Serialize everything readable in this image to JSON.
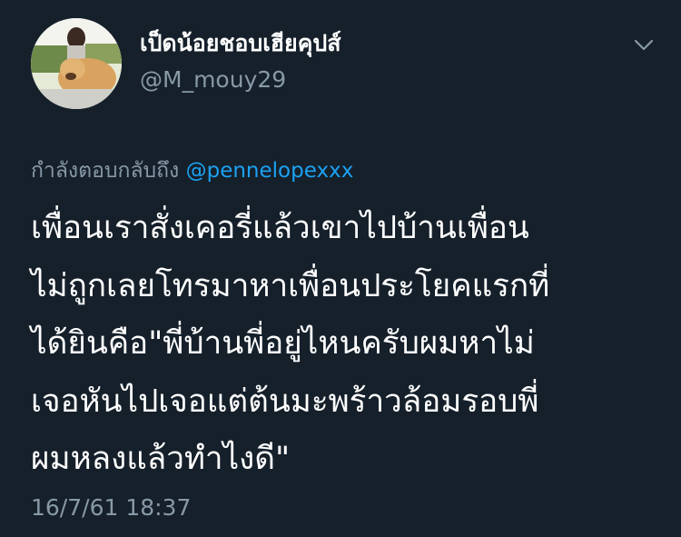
{
  "author": {
    "display_name": "เป็ดน้อยชอบเฮียคุปส์",
    "handle": "@M_mouy29"
  },
  "reply": {
    "prefix": "กำลังตอบกลับถึง",
    "mention": "@pennelopexxx"
  },
  "tweet": {
    "lines": [
      "เพื่อนเราสั่งเคอรี่แล้วเขาไปบ้านเพื่อน",
      "ไม่ถูกเลยโทรมาหาเพื่อนประโยคแรกที่",
      "ได้ยินคือ\"พี่บ้านพี่อยู่ไหนครับผมหาไม่",
      "เจอหันไปเจอแต่ต้นมะพร้าวล้อมรอบพี่",
      "ผมหลงแล้วทำไงดี\""
    ],
    "timestamp": "16/7/61 18:37"
  },
  "colors": {
    "background": "#15202b",
    "text_primary": "#ffffff",
    "text_secondary": "#8899a6",
    "mention": "#1da1f2"
  },
  "icons": {
    "menu": "chevron-down-icon"
  }
}
